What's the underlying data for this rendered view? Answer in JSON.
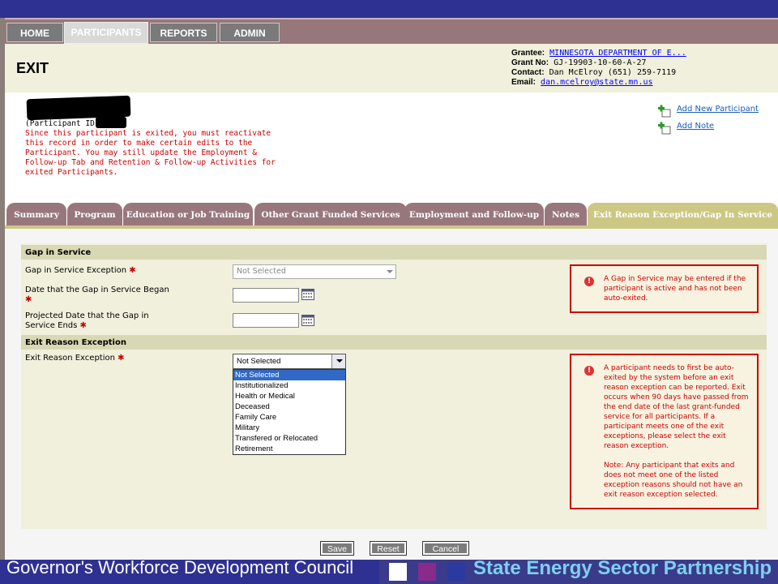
{
  "nav": {
    "tabs": [
      {
        "label": "HOME"
      },
      {
        "label": "PARTICIPANTS"
      },
      {
        "label": "REPORTS"
      },
      {
        "label": "ADMIN"
      }
    ]
  },
  "header": {
    "title": "EXIT",
    "grantee_label": "Grantee:",
    "grantee_value": "MINNESOTA DEPARTMENT OF E...",
    "grant_no_label": "Grant No:",
    "grant_no_value": "GJ-19903-10-60-A-27",
    "contact_label": "Contact:",
    "contact_value": "Dan McElroy (651) 259-7119",
    "email_label": "Email:",
    "email_value": "dan.mcelroy@state.mn.us"
  },
  "participant": {
    "id_label": "(Participant ID:",
    "exit_message": "Since this participant is exited, you must reactivate this record in order to make certain edits to the Participant. You may still update the Employment & Follow-up Tab and Retention & Follow-up Activities for exited Participants."
  },
  "actions": {
    "add_participant": "Add New Participant",
    "add_note": "Add Note"
  },
  "tabs": [
    {
      "label": "Summary"
    },
    {
      "label": "Program"
    },
    {
      "label": "Education or Job Training"
    },
    {
      "label": "Other Grant Funded Services"
    },
    {
      "label": "Employment and Follow-up"
    },
    {
      "label": "Notes"
    },
    {
      "label": "Exit Reason Exception/Gap In Service"
    }
  ],
  "gap": {
    "section_title": "Gap in Service",
    "exception_label": "Gap in Service Exception",
    "exception_value": "Not Selected",
    "began_label": "Date that the Gap in Service Began",
    "ends_label": "Projected Date that the Gap in Service Ends",
    "note": "A Gap in Service may be entered if the participant is active and has not been auto-exited."
  },
  "exit": {
    "section_title": "Exit Reason Exception",
    "exception_label": "Exit Reason Exception",
    "selected": "Not Selected",
    "options": [
      "Not Selected",
      "Institutionalized",
      "Health or Medical",
      "Deceased",
      "Family Care",
      "Military",
      "Transfered or Relocated",
      "Retirement"
    ],
    "note": "A participant needs to first be auto-exited by the system before an exit reason exception can be reported. Exit occurs when 90 days have passed from the end date of the last grant-funded service for all participants. If a participant meets one of the exit exceptions, please select the exit reason exception.",
    "note2": "Note: Any participant that exits and does not meet one of the listed exception reasons should not have an exit reason exception selected."
  },
  "buttons": {
    "save": "Save",
    "reset": "Reset",
    "cancel": "Cancel"
  },
  "footer": {
    "left": "Governor's Workforce Development Council",
    "right": "State Energy Sector Partnership"
  },
  "colors": {
    "brand": "#2e3192",
    "nav": "#98777c",
    "active_tab": "#ccc884",
    "error": "#cc0000"
  }
}
